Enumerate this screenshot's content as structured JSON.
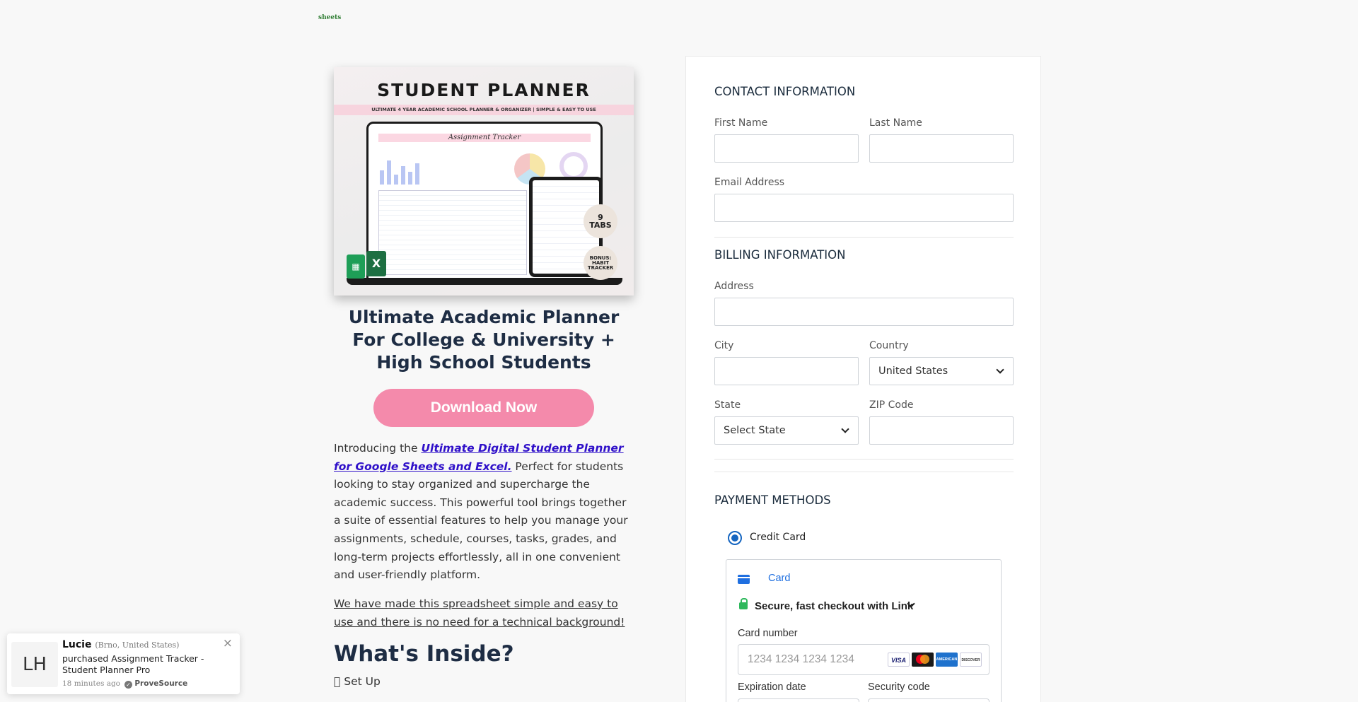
{
  "logo": {
    "text": "sheets"
  },
  "product": {
    "image": {
      "title": "STUDENT PLANNER",
      "subtitle": "ULTIMATE 4 YEAR ACADEMIC SCHOOL PLANNER & ORGANIZER | SIMPLE & EASY TO USE",
      "sheet_title": "Assignment Tracker",
      "badge_tabs_num": "9",
      "badge_tabs_text": "TABS",
      "badge_bonus": "BONUS:",
      "badge_habit": "HABIT",
      "badge_tracker": "TRACKER",
      "excel_letter": "X"
    },
    "title": "Ultimate Academic Planner For College & University + High School Students",
    "download_label": "Download Now",
    "intro_prefix": "Introducing the ",
    "intro_link": "Ultimate Digital Student Planner for Google Sheets and Excel.",
    "intro_suffix": " Perfect for students looking to stay organized and supercharge the academic success. This powerful tool brings together a suite of essential features to help you manage your assignments, schedule, courses, tasks, grades, and long-term projects effortlessly, all in one convenient and user-friendly platform.",
    "simple_text": " We have made this spreadsheet simple and easy to use and there is no need for a technical background!",
    "inside_heading": "What's Inside?",
    "setup_item": "\u0000 Set Up"
  },
  "contact": {
    "heading": "CONTACT INFORMATION",
    "first_name_label": "First Name",
    "last_name_label": "Last Name",
    "email_label": "Email Address"
  },
  "billing": {
    "heading": "BILLING INFORMATION",
    "address_label": "Address",
    "city_label": "City",
    "country_label": "Country",
    "country_value": "United States",
    "state_label": "State",
    "state_value": "Select State",
    "zip_label": "ZIP Code"
  },
  "payment": {
    "heading": "PAYMENT METHODS",
    "method_label": "Credit Card",
    "card_tab": "Card",
    "link_text": "Secure, fast checkout with Link",
    "card_number_label": "Card number",
    "card_number_placeholder": "1234 1234 1234 1234",
    "brands": {
      "visa": "VISA",
      "amex": "AMERICAN EXPRESS",
      "discover": "DISCOVER"
    },
    "expiration_label": "Expiration date",
    "security_label": "Security code"
  },
  "toast": {
    "initials": "LH",
    "name": "Lucie",
    "location": "(Brno, United States)",
    "message": "purchased Assignment Tracker - Student Planner Pro",
    "time": "18 minutes ago",
    "source": "ProveSource",
    "close": "×"
  }
}
